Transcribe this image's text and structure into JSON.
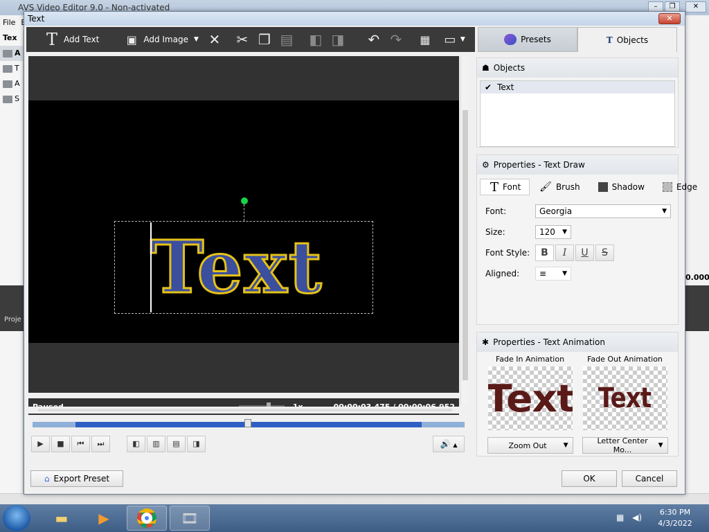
{
  "bg_app": {
    "title": "AVS Video Editor 9.0 - Non-activated",
    "menu": [
      "File",
      "E"
    ],
    "left_rows": [
      "A",
      "T",
      "A",
      "S"
    ],
    "label_text": "Tex",
    "time_fragment": "0.000",
    "proj_label": "Proje"
  },
  "dialog": {
    "title": "Text",
    "close_glyph": "✕"
  },
  "toolbar": {
    "add_text": "Add Text",
    "add_image": "Add Image"
  },
  "tabs": {
    "presets": "Presets",
    "objects": "Objects"
  },
  "preview": {
    "text": "Text",
    "status": "Paused",
    "speed": "1x",
    "time": "00:00:03.475  /  00:00:06.952"
  },
  "objects_panel": {
    "title": "Objects",
    "items": [
      {
        "label": "Text",
        "checked": true
      }
    ]
  },
  "text_draw": {
    "title": "Properties - Text Draw",
    "tabs": [
      "Font",
      "Brush",
      "Shadow",
      "Edge"
    ],
    "font_label": "Font:",
    "font_value": "Georgia",
    "size_label": "Size:",
    "size_value": "120",
    "style_label": "Font Style:",
    "style_buttons": [
      "B",
      "I",
      "U",
      "S"
    ],
    "aligned_label": "Aligned:"
  },
  "text_animation": {
    "title": "Properties - Text Animation",
    "fade_in_label": "Fade In Animation",
    "fade_out_label": "Fade Out Animation",
    "fade_in_value": "Zoom Out",
    "fade_out_value": "Letter Center Mo...",
    "fade_in_preview": "Text",
    "fade_out_preview": "Text"
  },
  "footer": {
    "export_preset": "Export Preset",
    "ok": "OK",
    "cancel": "Cancel"
  },
  "taskbar": {
    "time": "6:30 PM",
    "date": "4/3/2022"
  },
  "colors": {
    "text_fill": "#3b4f9e",
    "text_outline": "#e6c218",
    "timeline_progress": "#2f5fc4",
    "handle": "#19d446"
  }
}
